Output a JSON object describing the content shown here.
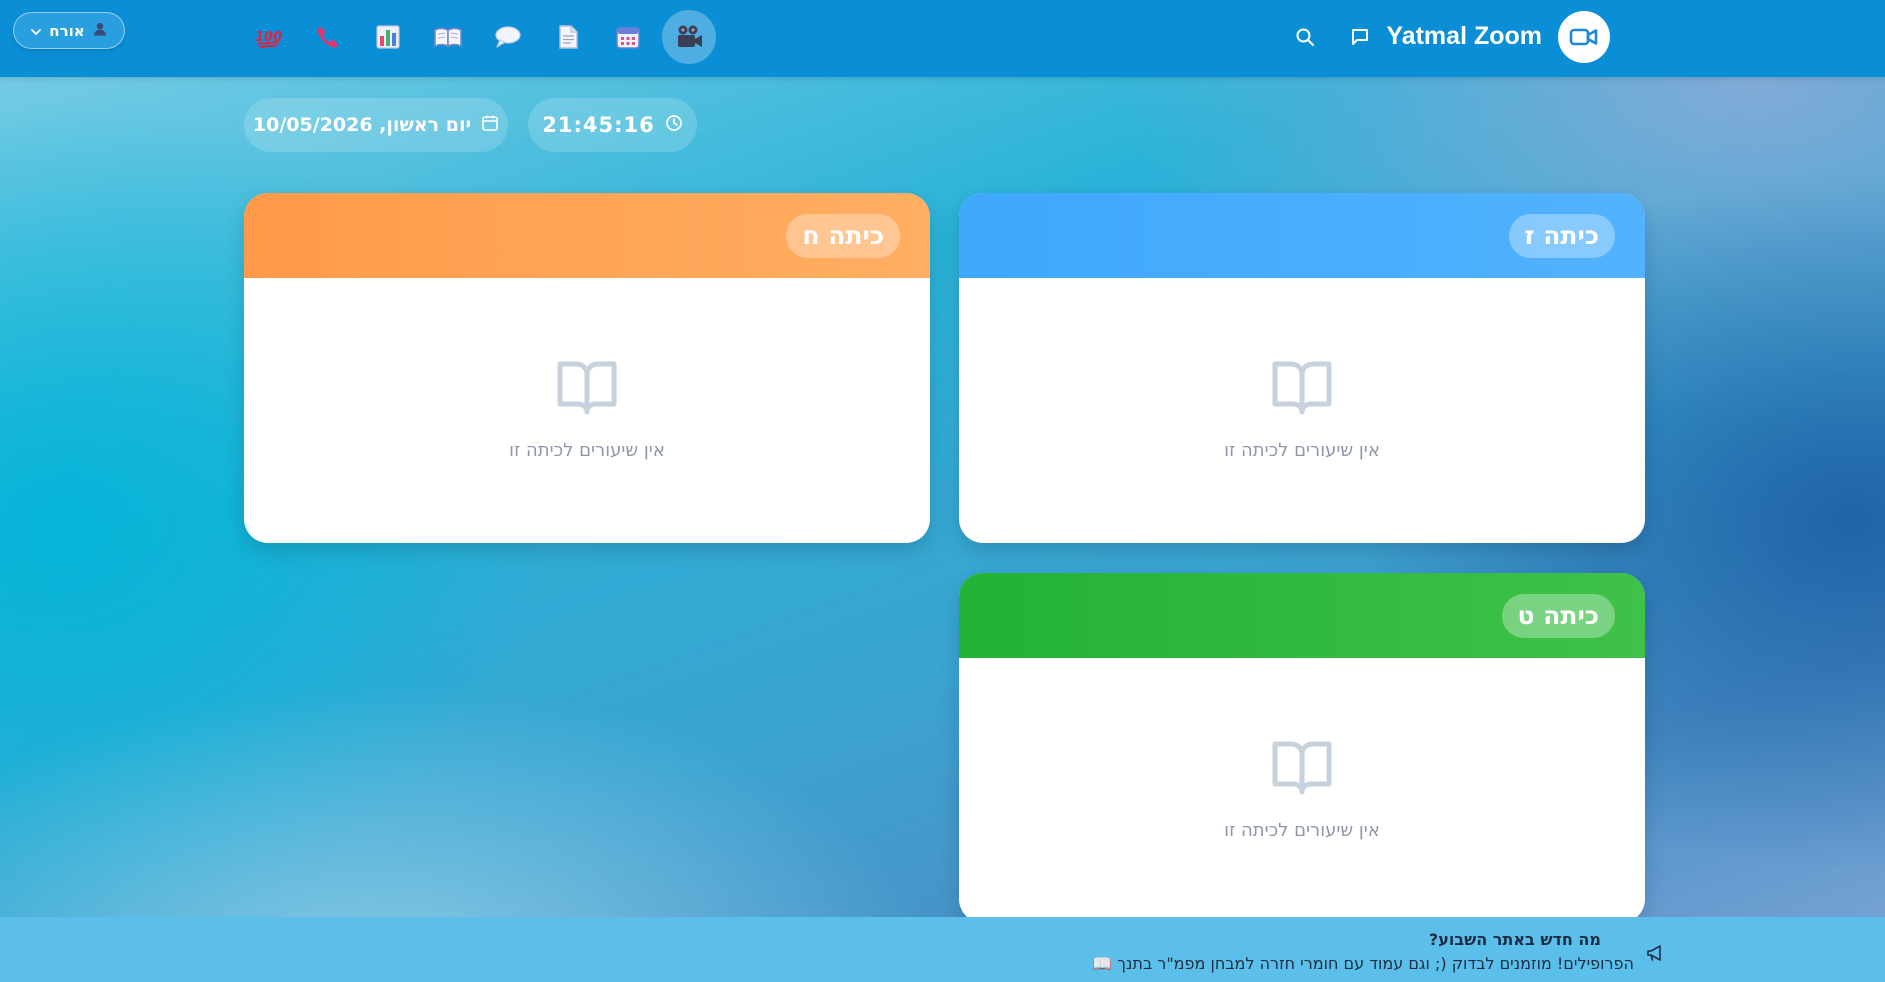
{
  "header": {
    "brand_title": "Yatmal Zoom",
    "user_label": "אורח",
    "nav": [
      {
        "name": "zoom-lessons",
        "icon": "movie-camera-icon",
        "active": true
      },
      {
        "name": "calendar",
        "icon": "calendar-icon"
      },
      {
        "name": "documents",
        "icon": "document-icon"
      },
      {
        "name": "chat",
        "icon": "speech-bubble-icon"
      },
      {
        "name": "library",
        "icon": "open-book-icon"
      },
      {
        "name": "statistics",
        "icon": "bar-chart-icon"
      },
      {
        "name": "phone",
        "icon": "phone-icon"
      },
      {
        "name": "hundred",
        "icon": "hundred-points-icon"
      }
    ]
  },
  "datetime": {
    "date": "יום ראשון, 10/05/2026",
    "time": "21:45:16"
  },
  "classes": [
    {
      "title": "כיתה ז",
      "color_from": "#3ea8fd",
      "color_to": "#52b2fd",
      "empty_text": "אין שיעורים לכיתה זו"
    },
    {
      "title": "כיתה ח",
      "color_from": "#ff9a4a",
      "color_to": "#ffae62",
      "empty_text": "אין שיעורים לכיתה זו"
    },
    {
      "title": "כיתה ט",
      "color_from": "#22b235",
      "color_to": "#3fc14a",
      "empty_text": "אין שיעורים לכיתה זו"
    }
  ],
  "footer": {
    "title": "מה חדש באתר השבוע?",
    "text": "הפרופילים! מוזמנים לבדוק (; וגם עמוד עם חומרי חזרה למבחן מפמ\"ר בתנך 📖"
  },
  "colors": {
    "topbar": "#0a8fd6",
    "footer": "#5bbfe9",
    "brand_icon": "#1f86d8"
  }
}
